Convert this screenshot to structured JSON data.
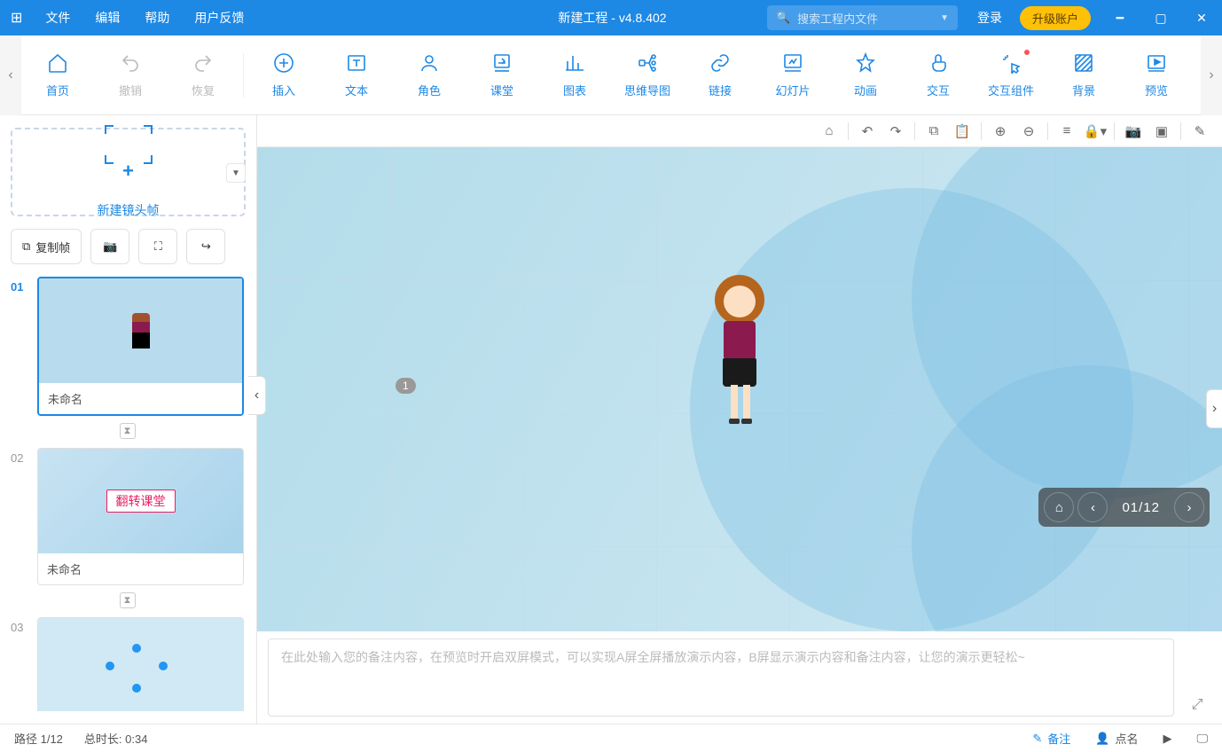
{
  "titlebar": {
    "menu": {
      "file": "文件",
      "edit": "编辑",
      "help": "帮助",
      "feedback": "用户反馈"
    },
    "title": "新建工程 - v4.8.402",
    "search_placeholder": "搜索工程内文件",
    "login": "登录",
    "upgrade": "升级账户"
  },
  "ribbon": {
    "home": "首页",
    "undo": "撤销",
    "redo": "恢复",
    "insert": "插入",
    "text": "文本",
    "role": "角色",
    "classroom": "课堂",
    "chart": "图表",
    "mindmap": "思维导图",
    "link": "链接",
    "slide": "幻灯片",
    "animation": "动画",
    "interact": "交互",
    "component": "交互组件",
    "background": "背景",
    "preview": "预览"
  },
  "sidebar": {
    "new_frame": "新建镜头帧",
    "copy_frame": "复制帧",
    "frames": [
      {
        "index": "01",
        "label": "未命名"
      },
      {
        "index": "02",
        "label": "未命名",
        "thumb_text": "翻转课堂"
      },
      {
        "index": "03",
        "label": ""
      }
    ]
  },
  "canvas": {
    "marker": "1",
    "nav": {
      "pos": "01/12"
    }
  },
  "notes": {
    "placeholder": "在此处输入您的备注内容，在预览时开启双屏模式，可以实现A屏全屏播放演示内容，B屏显示演示内容和备注内容，让您的演示更轻松~"
  },
  "status": {
    "path": "路径 1/12",
    "duration": "总时长: 0:34",
    "notes_btn": "备注",
    "naming_btn": "点名"
  }
}
